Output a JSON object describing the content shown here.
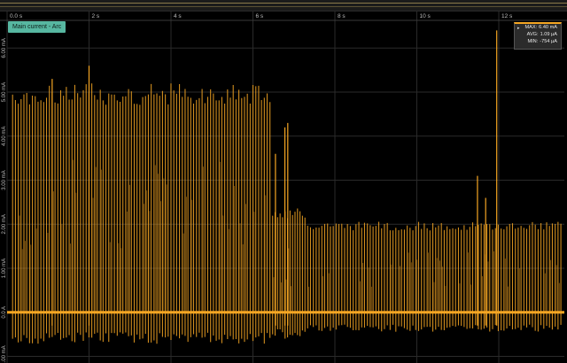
{
  "channel": {
    "label": "Main current - Arc"
  },
  "stats": {
    "max_label": "MAX:",
    "max_value": "6.40 mA",
    "avg_label": "AVG:",
    "avg_value": "1.09 µA",
    "min_label": "MIN:",
    "min_value": "-754 µA"
  },
  "colors": {
    "trace": "#f5a623",
    "channel_label_bg": "#57b7a1",
    "background": "#000000",
    "grid": "#2a2a2a"
  },
  "chart_data": {
    "type": "line",
    "title": "",
    "xlabel": "",
    "ylabel": "",
    "x_ticks": [
      "0.0 s",
      "2 s",
      "4 s",
      "6 s",
      "8 s",
      "10 s",
      "12 s"
    ],
    "x_tick_values": [
      0,
      2,
      4,
      6,
      8,
      10,
      12
    ],
    "y_ticks": [
      "6.00 mA",
      "5.00 mA",
      "4.00 mA",
      "3.00 mA",
      "2.00 mA",
      "1.00 mA",
      "0.0 A",
      "-1.00 mA"
    ],
    "y_tick_values": [
      6,
      5,
      4,
      3,
      2,
      1,
      0,
      -1
    ],
    "xlim": [
      0,
      13.6
    ],
    "ylim": [
      -1.15,
      6.85
    ],
    "y_unit": "mA",
    "grid": true,
    "baseline": 0,
    "series": [
      {
        "segments": [
          {
            "x_start": 0.1,
            "x_end": 6.45,
            "spike_count": 92,
            "peak": 5.05,
            "dip": -0.65
          },
          {
            "x_start": 6.45,
            "x_end": 7.3,
            "spike_count": 14,
            "peak": 2.3,
            "dip": -0.55
          },
          {
            "x_start": 7.3,
            "x_end": 13.55,
            "spike_count": 90,
            "peak": 2.0,
            "dip": -0.4
          }
        ],
        "outliers": [
          {
            "x": 2.0,
            "y": 5.6
          },
          {
            "x": 1.1,
            "y": 5.3
          },
          {
            "x": 6.78,
            "y": 4.2
          },
          {
            "x": 6.85,
            "y": 4.3
          },
          {
            "x": 6.55,
            "y": 3.6
          },
          {
            "x": 11.48,
            "y": 3.1
          },
          {
            "x": 11.68,
            "y": 2.6
          },
          {
            "x": 11.95,
            "y": 6.4
          }
        ]
      }
    ]
  }
}
